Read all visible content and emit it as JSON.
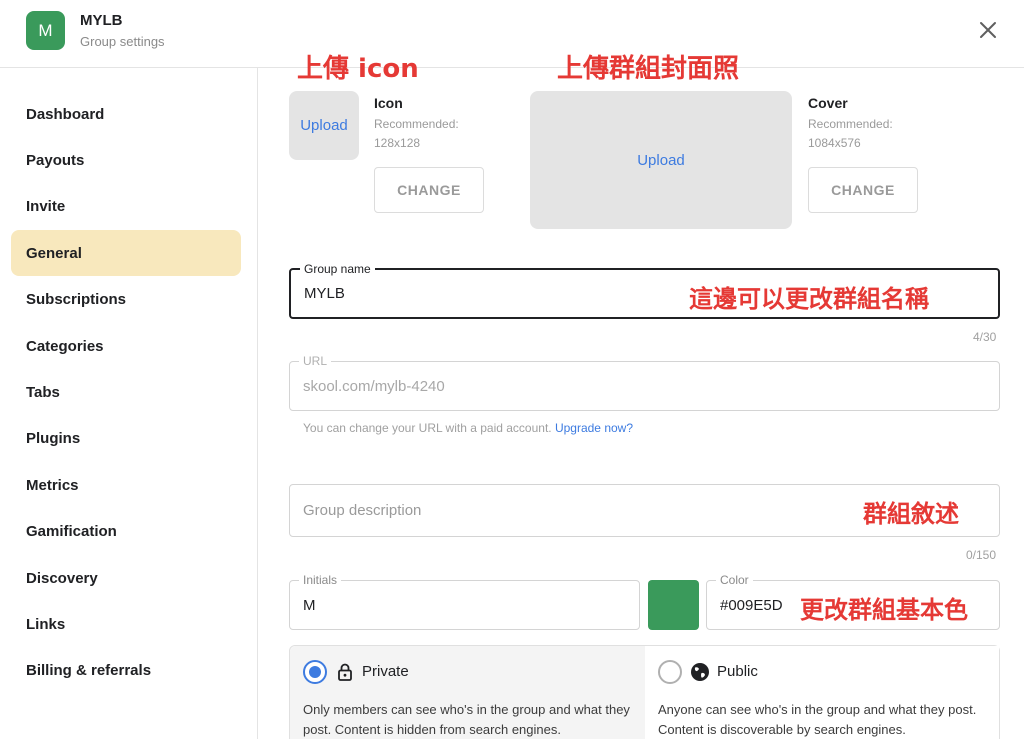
{
  "header": {
    "avatar_letter": "M",
    "avatar_color": "#3a9a5b",
    "group_name": "MYLB",
    "subtitle": "Group settings"
  },
  "sidebar": {
    "active_index": 3,
    "active_bg": "#f8e8bd",
    "items": [
      {
        "label": "Dashboard"
      },
      {
        "label": "Payouts"
      },
      {
        "label": "Invite"
      },
      {
        "label": "General"
      },
      {
        "label": "Subscriptions"
      },
      {
        "label": "Categories"
      },
      {
        "label": "Tabs"
      },
      {
        "label": "Plugins"
      },
      {
        "label": "Metrics"
      },
      {
        "label": "Gamification"
      },
      {
        "label": "Discovery"
      },
      {
        "label": "Links"
      },
      {
        "label": "Billing & referrals"
      }
    ]
  },
  "annotations": {
    "upload_icon": "上傳 icon",
    "upload_cover": "上傳群組封面照",
    "change_name": "這邊可以更改群組名稱",
    "description": "群組敘述",
    "change_color": "更改群組基本色"
  },
  "icon_upload": {
    "button": "Upload",
    "title": "Icon",
    "recommended": "Recommended:",
    "size": "128x128",
    "change": "CHANGE"
  },
  "cover_upload": {
    "button": "Upload",
    "title": "Cover",
    "recommended": "Recommended:",
    "size": "1084x576",
    "change": "CHANGE"
  },
  "group_name_field": {
    "label": "Group name",
    "value": "MYLB",
    "counter": "4/30"
  },
  "url_field": {
    "label": "URL",
    "value": "skool.com/mylb-4240",
    "helper": "You can change your URL with a paid account.",
    "upgrade_link": "Upgrade now?"
  },
  "description_field": {
    "placeholder": "Group description",
    "counter": "0/150"
  },
  "initials_field": {
    "label": "Initials",
    "value": "M"
  },
  "color_field": {
    "label": "Color",
    "value": "#009E5D",
    "swatch": "#3a9a5b"
  },
  "privacy": {
    "selected": "private",
    "private": {
      "label": "Private",
      "icon": "lock-icon",
      "description": "Only members can see who's in the group and what they post. Content is hidden from search engines."
    },
    "public": {
      "label": "Public",
      "icon": "globe-icon",
      "description": "Anyone can see who's in the group and what they post. Content is discoverable by search engines."
    }
  }
}
